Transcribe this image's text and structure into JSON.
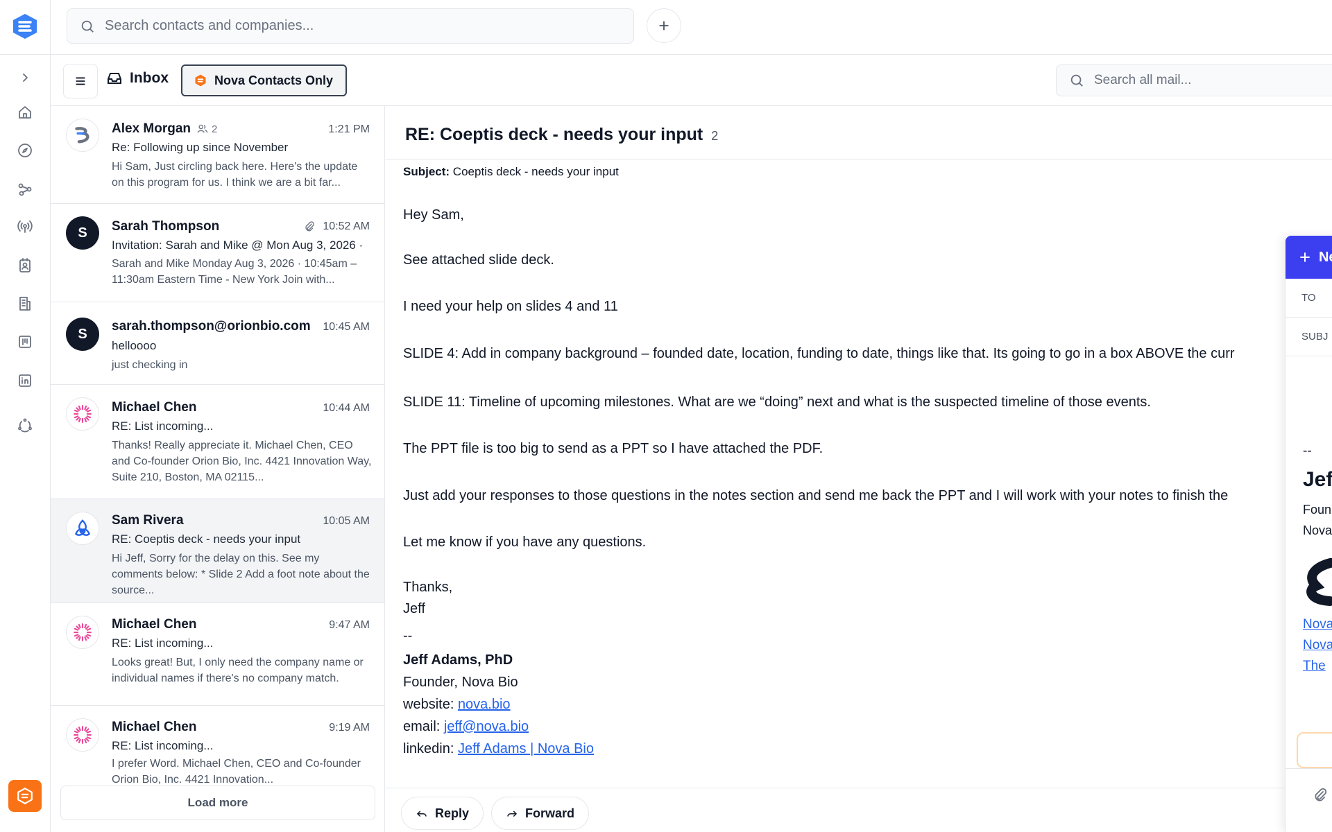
{
  "search": {
    "placeholder": "Search contacts and companies..."
  },
  "toolbar": {
    "inbox_label": "Inbox",
    "filter_label": "Nova Contacts Only",
    "mail_search_placeholder": "Search all mail..."
  },
  "messages": [
    {
      "sender": "Alex Morgan",
      "participants": "2",
      "time": "1:21 PM",
      "subject": "Re: Following up since November",
      "preview": "Hi Sam, Just circling back here. Here's the update on this program for us. I think we are a bit far..."
    },
    {
      "sender": "Sarah Thompson",
      "time": "10:52 AM",
      "initial": "S",
      "subject": "Invitation: Sarah and Mike @ Mon Aug 3, 2026 ·",
      "preview": "Sarah and Mike Monday Aug 3, 2026 · 10:45am – 11:30am Eastern Time - New York Join with..."
    },
    {
      "sender": "sarah.thompson@orionbio.com",
      "time": "10:45 AM",
      "initial": "S",
      "subject": "helloooo",
      "preview": "just checking in"
    },
    {
      "sender": "Michael Chen",
      "time": "10:44 AM",
      "subject": "RE: List incoming...",
      "preview": "Thanks! Really appreciate it. Michael Chen, CEO and Co-founder Orion Bio, Inc. 4421 Innovation Way, Suite 210, Boston, MA 02115..."
    },
    {
      "sender": "Sam Rivera",
      "time": "10:05 AM",
      "subject": "RE: Coeptis deck - needs your input",
      "preview": "Hi Jeff, Sorry for the delay on this. See my comments below: * Slide 2 Add a foot note about the source..."
    },
    {
      "sender": "Michael Chen",
      "time": "9:47 AM",
      "subject": "RE: List incoming...",
      "preview": "Looks great! But, I only need the company name or individual names if there's no company match."
    },
    {
      "sender": "Michael Chen",
      "time": "9:19 AM",
      "subject": "RE: List incoming...",
      "preview": "I prefer Word. Michael Chen, CEO and Co-founder Orion Bio, Inc. 4421 Innovation..."
    }
  ],
  "load_more": "Load more",
  "reader": {
    "title": "RE: Coeptis deck - needs your input",
    "count": "2",
    "subject_label": "Subject:",
    "subject": "Coeptis deck - needs your input",
    "lines": [
      "Hey Sam,",
      "See attached slide deck.",
      "I need your help on slides 4 and 11",
      "SLIDE 4: Add in company background – founded date, location, funding to date, things like that. Its going to go in a box ABOVE the curr",
      "SLIDE 11: Timeline of upcoming milestones. What are we “doing” next and what is the suspected timeline of those events.",
      "The PPT file is too big to send as a PPT so I have attached the PDF.",
      "Just add your responses to those questions in the notes section and send me back the PPT and I will work with your notes to finish the",
      "Let me know if you have any questions.",
      "Thanks,",
      "Jeff",
      "--"
    ],
    "sig_name": "Jeff Adams, PhD",
    "sig_title": "Founder, Nova Bio",
    "website_label": "website:",
    "website": "nova.bio",
    "email_label": "email:",
    "email": "jeff@nova.bio",
    "linkedin_label": "linkedin:",
    "linkedin": "Jeff Adams | Nova Bio",
    "reply_label": "Reply",
    "forward_label": "Forward"
  },
  "compose": {
    "header": "Ne",
    "to_label": "TO",
    "subj_label": "SUBJ",
    "sep": "--",
    "name": "Jef",
    "line1": "Foun",
    "line2": "Nova",
    "link1": "Nova",
    "link2": "Nova",
    "link3": "The"
  },
  "colors": {
    "accent": "#3b3ff0",
    "brand_orange": "#f97316",
    "link": "#2563eb"
  }
}
